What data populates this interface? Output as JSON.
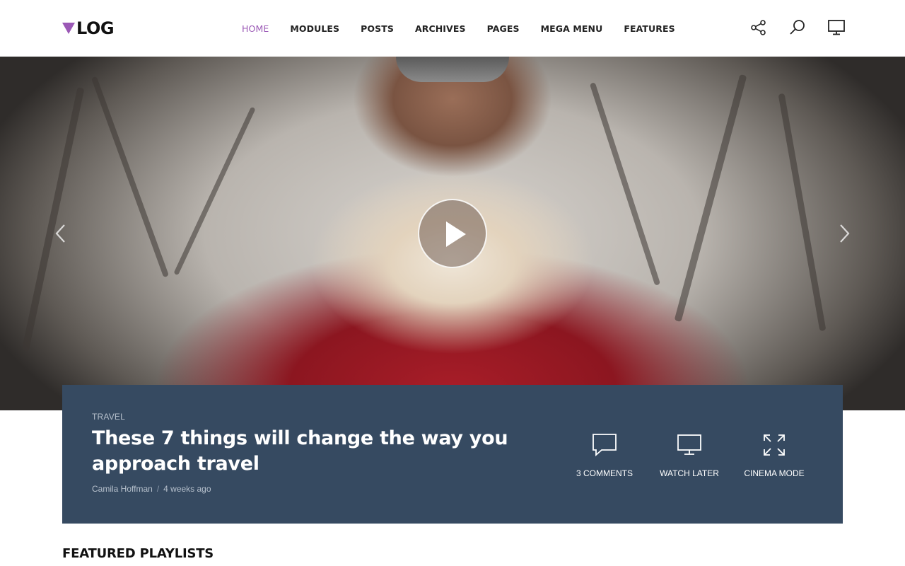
{
  "logo": {
    "text": "LOG",
    "accent": "#9b59b6"
  },
  "nav": {
    "items": [
      {
        "label": "HOME",
        "active": true
      },
      {
        "label": "MODULES"
      },
      {
        "label": "POSTS"
      },
      {
        "label": "ARCHIVES"
      },
      {
        "label": "PAGES"
      },
      {
        "label": "MEGA MENU"
      },
      {
        "label": "FEATURES"
      }
    ],
    "active_color": "#9b59b6"
  },
  "header_icons": [
    "share-icon",
    "search-icon",
    "monitor-icon"
  ],
  "hero": {
    "controls": [
      "play-icon",
      "chevron-left-icon",
      "chevron-right-icon"
    ]
  },
  "post": {
    "category": "TRAVEL",
    "title": "These 7 things will change the way you approach travel",
    "author": "Camila Hoffman",
    "separator": "/",
    "time": "4 weeks ago",
    "card_color": "#364a61"
  },
  "actions": [
    {
      "label": "3 COMMENTS",
      "icon": "comment-icon"
    },
    {
      "label": "WATCH LATER",
      "icon": "monitor-icon"
    },
    {
      "label": "CINEMA MODE",
      "icon": "expand-icon"
    }
  ],
  "section": {
    "title": "FEATURED PLAYLISTS"
  }
}
